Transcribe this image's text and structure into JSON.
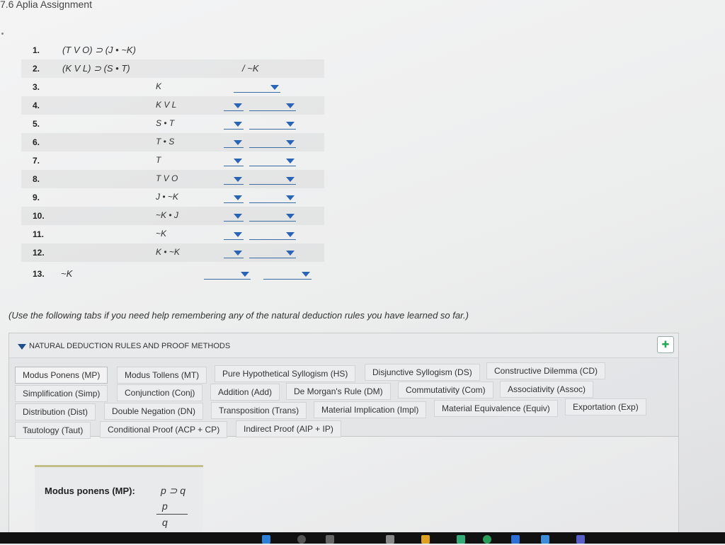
{
  "page": {
    "title": "7.6 Aplia Assignment"
  },
  "proof": {
    "premises": [
      {
        "num": "1.",
        "formula": "(T V O) ⊃ (J • ~K)"
      },
      {
        "num": "2.",
        "formula": "(K V L) ⊃ (S • T)",
        "conclusion": "/ ~K"
      }
    ],
    "steps": [
      {
        "num": "3.",
        "formula": "K"
      },
      {
        "num": "4.",
        "formula": "K V L"
      },
      {
        "num": "5.",
        "formula": "S • T"
      },
      {
        "num": "6.",
        "formula": "T • S"
      },
      {
        "num": "7.",
        "formula": "T"
      },
      {
        "num": "8.",
        "formula": "T V O"
      },
      {
        "num": "9.",
        "formula": "J • ~K"
      },
      {
        "num": "10.",
        "formula": "~K • J"
      },
      {
        "num": "11.",
        "formula": "~K"
      },
      {
        "num": "12.",
        "formula": "K • ~K"
      }
    ],
    "final": {
      "num": "13.",
      "formula": "~K"
    }
  },
  "help_note": "(Use the following tabs if you need help remembering any of the natural deduction rules you have learned so far.)",
  "rules_panel": {
    "title": "NATURAL DEDUCTION RULES AND PROOF METHODS",
    "pin_icon": "✚",
    "tabs": [
      "Modus Ponens (MP)",
      "Modus Tollens (MT)",
      "Pure Hypothetical Syllogism (HS)",
      "Disjunctive Syllogism (DS)",
      "Constructive Dilemma (CD)",
      "Simplification (Simp)",
      "Conjunction (Conj)",
      "Addition (Add)",
      "De Morgan's Rule (DM)",
      "Commutativity (Com)",
      "Associativity (Assoc)",
      "Distribution (Dist)",
      "Double Negation (DN)",
      "Transposition (Trans)",
      "Material Implication (Impl)",
      "Material Equivalence (Equiv)",
      "Exportation (Exp)",
      "Tautology (Taut)",
      "Conditional Proof (ACP + CP)",
      "Indirect Proof (AIP + IP)"
    ],
    "active_tab": "Modus Ponens (MP)",
    "rule_display": {
      "label": "Modus ponens (MP):",
      "line1": "p ⊃ q",
      "line2": "p",
      "line3": "q"
    }
  },
  "colors": {
    "dropdown_arrow": "#2a64b5",
    "accent": "#1f4d8c"
  }
}
